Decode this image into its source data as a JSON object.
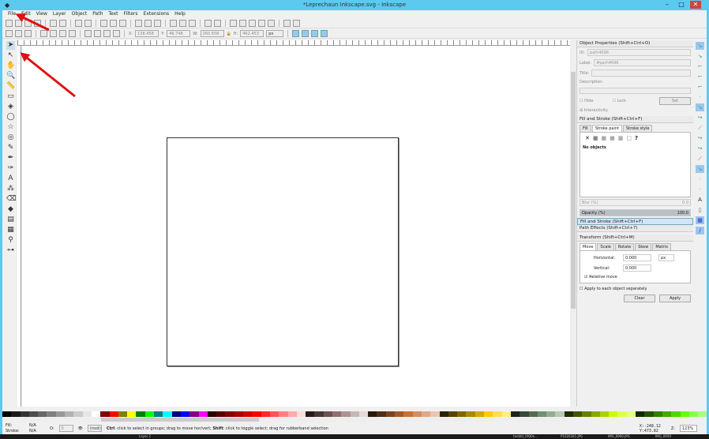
{
  "window": {
    "title": "*Leprechaun Inkscape.svg - Inkscape",
    "minimize": "–",
    "maximize": "□",
    "close": "✕"
  },
  "menu": [
    "File",
    "Edit",
    "View",
    "Layer",
    "Object",
    "Path",
    "Text",
    "Filters",
    "Extensions",
    "Help"
  ],
  "toolbar": {
    "x_label": "X:",
    "x": "138.458",
    "y_label": "Y:",
    "y": "46.748",
    "w_label": "W:",
    "w": "260.658",
    "h_label": "H:",
    "h": "462.453",
    "unit": "px"
  },
  "tools": [
    "select",
    "node",
    "tweak",
    "zoom",
    "measure",
    "rect",
    "3dbox",
    "ellipse",
    "star",
    "spiral",
    "pencil",
    "pen",
    "calligraphy",
    "text",
    "spray",
    "eraser",
    "bucket",
    "gradient",
    "mesh",
    "dropper",
    "connector"
  ],
  "object_properties": {
    "title": "Object Properties (Shift+Ctrl+O)",
    "id_label": "ID:",
    "id": "path4696",
    "label_label": "Label:",
    "label": "#path4696",
    "title_label": "Title:",
    "description_label": "Description:",
    "hide": "Hide",
    "lock": "Lock",
    "set": "Set",
    "interactivity": "Interactivity"
  },
  "fill_stroke": {
    "title": "Fill and Stroke (Shift+Ctrl+F)",
    "tabs": [
      "Fill",
      "Stroke paint",
      "Stroke style"
    ],
    "paint_icons": [
      "✕",
      "■",
      "■",
      "■",
      "▦",
      "□",
      "?"
    ],
    "no_objects": "No objects",
    "blur_label": "Blur (%)",
    "blur": "0.0",
    "opacity_label": "Opacity (%)",
    "opacity": "100.0",
    "opacity_fraction": 1.0
  },
  "collapsed": [
    "Fill and Stroke (Shift+Ctrl+F)",
    "Path Effects (Shift+Ctrl+7)"
  ],
  "transform": {
    "title": "Transform (Shift+Ctrl+M)",
    "tabs": [
      "Move",
      "Scale",
      "Rotate",
      "Skew",
      "Matrix"
    ],
    "horizontal_label": "Horizontal:",
    "horizontal": "0.000",
    "vertical_label": "Vertical:",
    "vertical": "0.000",
    "unit": "px",
    "relative_move": "Relative move",
    "apply_each": "Apply to each object separately",
    "clear": "Clear",
    "apply": "Apply"
  },
  "status": {
    "fill_label": "Fill:",
    "fill": "N/A",
    "stroke_label": "Stroke:",
    "stroke": "N/A",
    "o_label": "O:",
    "o": "0",
    "layer": "(root)",
    "message_ctrl": "Ctrl",
    "message_1": ": click to select in groups; drag to move hor/vert; ",
    "message_shift": "Shift",
    "message_2": ": click to toggle select; drag for rubberband selection",
    "x_label": "X:",
    "x": "-248.12",
    "y_label": "Y:",
    "y": "473.82",
    "zoom_label": "Z:",
    "zoom": "123%"
  },
  "taskbar": [
    "Layer 2",
    "tumblr_l9Q0x...",
    "P1020341.JPG",
    "IMG_0960.JPG",
    "IMG_0959"
  ],
  "palette": [
    "#000",
    "#1a1a1a",
    "#333",
    "#4d4d4d",
    "#666",
    "#808080",
    "#999",
    "#b3b3b3",
    "#ccc",
    "#e6e6e6",
    "#fff",
    "#800000",
    "#f00",
    "#808000",
    "#ff0",
    "#008000",
    "#0f0",
    "#008080",
    "#0ff",
    "#000080",
    "#00f",
    "#800080",
    "#f0f",
    "#2b0000",
    "#550000",
    "#800000",
    "#aa0000",
    "#d40000",
    "#f00",
    "#ff2a2a",
    "#f55",
    "#ff8080",
    "#faa",
    "#fdd",
    "#241c1c",
    "#483737",
    "#6c5353",
    "#916f6f",
    "#ac9393",
    "#c8b7b7",
    "#e3dbdb",
    "#28170b",
    "#502d16",
    "#784421",
    "#a05a2c",
    "#c87137",
    "#d38d5f",
    "#deaa87",
    "#e9c6af",
    "#2b2200",
    "#554400",
    "#806600",
    "#aa8800",
    "#d4aa00",
    "#fc0",
    "#fd5",
    "#fe8",
    "#1c241c",
    "#374837",
    "#536c53",
    "#6f916f",
    "#93ac93",
    "#b7c8b7",
    "#222b00",
    "#445500",
    "#668000",
    "#88aa00",
    "#aad400",
    "#cf0",
    "#df5",
    "#e5ff80",
    "#112b00",
    "#225500",
    "#338000",
    "#44aa00",
    "#55d400",
    "#6f0",
    "#8f5",
    "#aaff80"
  ]
}
